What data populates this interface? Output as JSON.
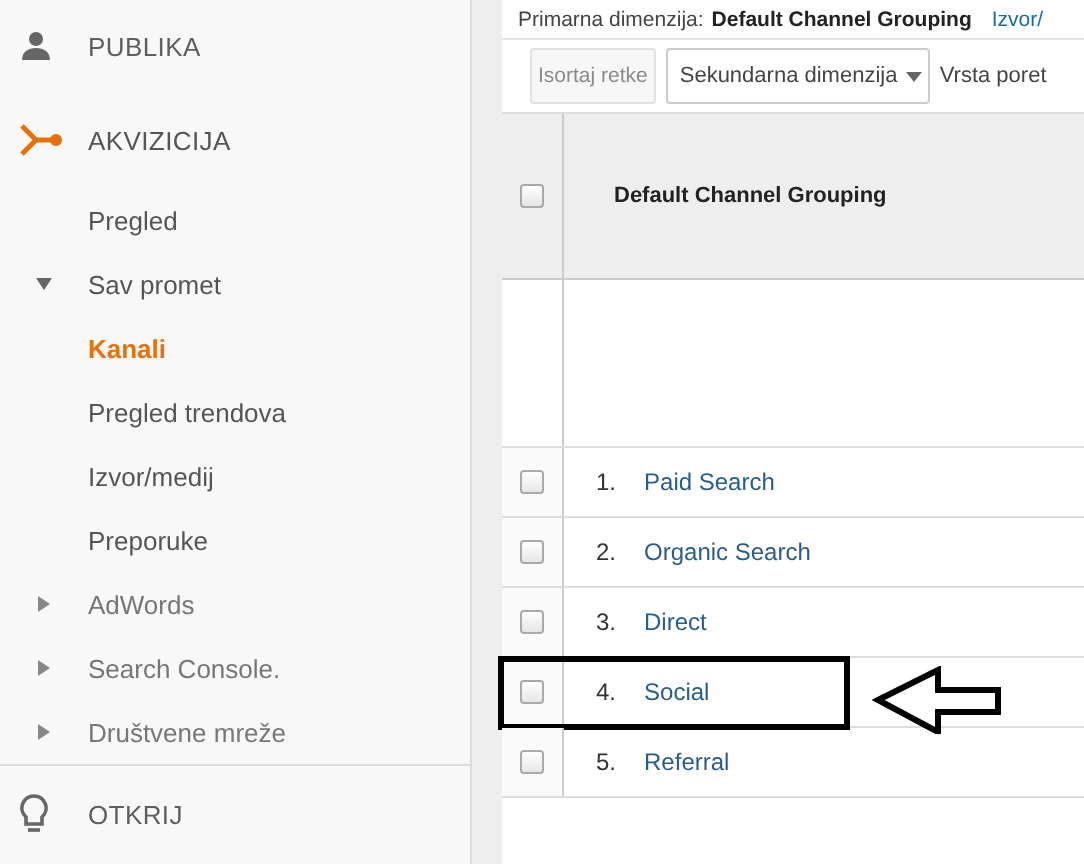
{
  "sidebar": {
    "sections": [
      {
        "label": "PUBLIKA",
        "selected": false
      },
      {
        "label": "AKVIZICIJA",
        "selected": true,
        "children": [
          {
            "label": "Pregled",
            "selected": false
          },
          {
            "label": "Sav promet",
            "expanded": true,
            "selected": false,
            "children": [
              {
                "label": "Kanali",
                "selected": true
              },
              {
                "label": "Pregled trendova",
                "selected": false
              },
              {
                "label": "Izvor/medij",
                "selected": false
              },
              {
                "label": "Preporuke",
                "selected": false
              }
            ]
          },
          {
            "label": "AdWords",
            "expanded": false,
            "selected": false
          },
          {
            "label": "Search Console.",
            "expanded": false,
            "selected": false
          },
          {
            "label": "Društvene mreže",
            "expanded": false,
            "selected": false
          }
        ]
      },
      {
        "label": "OTKRIJ",
        "selected": false
      }
    ]
  },
  "primary_dimension": {
    "label": "Primarna dimenzija:",
    "value": "Default Channel Grouping",
    "link": "Izvor/"
  },
  "toolbar": {
    "plot_button": {
      "label": "Isortaj retke",
      "disabled": true
    },
    "secondary_dimension": "Sekundarna dimenzija",
    "sort_label": "Vrsta poret"
  },
  "table": {
    "header": {
      "label": "Default Channel Grouping",
      "checked": false
    },
    "rows": [
      {
        "index": "1.",
        "name": "Paid Search",
        "checked": false,
        "highlighted": false
      },
      {
        "index": "2.",
        "name": "Organic Search",
        "checked": false,
        "highlighted": false
      },
      {
        "index": "3.",
        "name": "Direct",
        "checked": false,
        "highlighted": false
      },
      {
        "index": "4.",
        "name": "Social",
        "checked": false,
        "highlighted": true
      },
      {
        "index": "5.",
        "name": "Referral",
        "checked": false,
        "highlighted": false
      }
    ]
  }
}
